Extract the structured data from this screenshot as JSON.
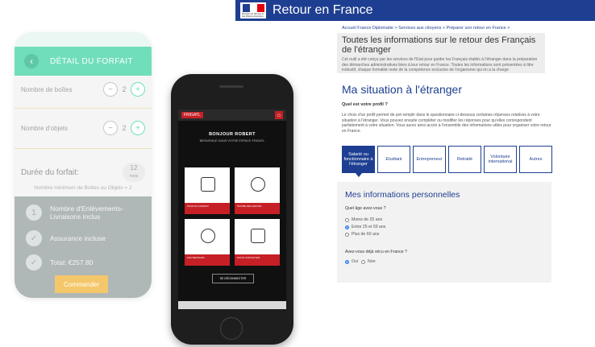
{
  "phone1": {
    "header_title": "DÉTAIL DU FORFAIT",
    "boxes": {
      "label": "Nombre de boîtes",
      "value": "2"
    },
    "objects": {
      "label": "Nombre d'objets",
      "value": "2"
    },
    "duration": {
      "label": "Durée du forfait:",
      "value": "12",
      "unit": "mois"
    },
    "minimum_note": "Nombre minimum de Boîtes ou Objets = 2",
    "items": [
      {
        "badge": "1",
        "text": "Nombre d'Enlèvements-Livraisons inclus"
      },
      {
        "badge": "✓",
        "text": "Assurance incluse"
      },
      {
        "badge": "✓",
        "text": "Total: €257.80"
      }
    ],
    "cta_label": "Commander"
  },
  "phone2": {
    "brand": "FRIGATL",
    "greeting": "BONJOUR ROBERT",
    "subtitle": "BIENVENUE DANS VOTRE ESPACE FRIGATL",
    "tiles": [
      {
        "label": "SCAN DU FORFAIT"
      },
      {
        "label": "SUIVRE DES ENVOIS"
      },
      {
        "label": "LES SERVICES"
      },
      {
        "label": "NOUS CONTACTER"
      }
    ],
    "logout": "SE DÉCONNECTER"
  },
  "site": {
    "header_title": "Retour en France",
    "flag_caption": "Ministère de l'Europe et des Affaires étrangères",
    "breadcrumb": "Accueil France Diplomatie > Services aux citoyens > Préparer son retour en France >",
    "intro_title": "Toutes les informations sur le retour des Français de l'étranger",
    "intro_text": "Cet outil a été conçu par les services de l'Etat pour guider les Français établis à l'étranger dans la préparation des démarches administratives liées à leur retour en France. Toutes les informations sont présentées à titre indicatif, chaque formalité reste de la compétence exclusive de l'organisme qui en a la charge",
    "situation_title": "Ma situation à l'étranger",
    "profile_question": "Quel est votre profil ?",
    "profile_desc": "Le choix d'un profil permet de pré-remplir dans le questionnaire ci-dessous certaines réponses relatives à votre situation à l'étranger. Vous pouvez ensuite compléter ou modifier les réponses pour qu'elles correspondent parfaitement à votre situation. Vous aurez ainsi accès à l'ensemble des informations utiles pour organiser votre retour en France.",
    "tabs": [
      {
        "label": "Salarié ou fonctionnaire à l'étranger"
      },
      {
        "label": "Etudiant"
      },
      {
        "label": "Entrepreneur"
      },
      {
        "label": "Retraité"
      },
      {
        "label": "Volontaire international"
      },
      {
        "label": "Autres"
      }
    ],
    "personal_title": "Mes informations personnelles",
    "age_question": "Quel âge avez-vous ?",
    "age_options": [
      "Moins de 25 ans",
      "Entre 25 et 59 ans",
      "Plus de 60 ans"
    ],
    "lived_question": "Avez-vous déjà vécu en France ?",
    "lived_options": [
      "Oui",
      "Non"
    ]
  }
}
